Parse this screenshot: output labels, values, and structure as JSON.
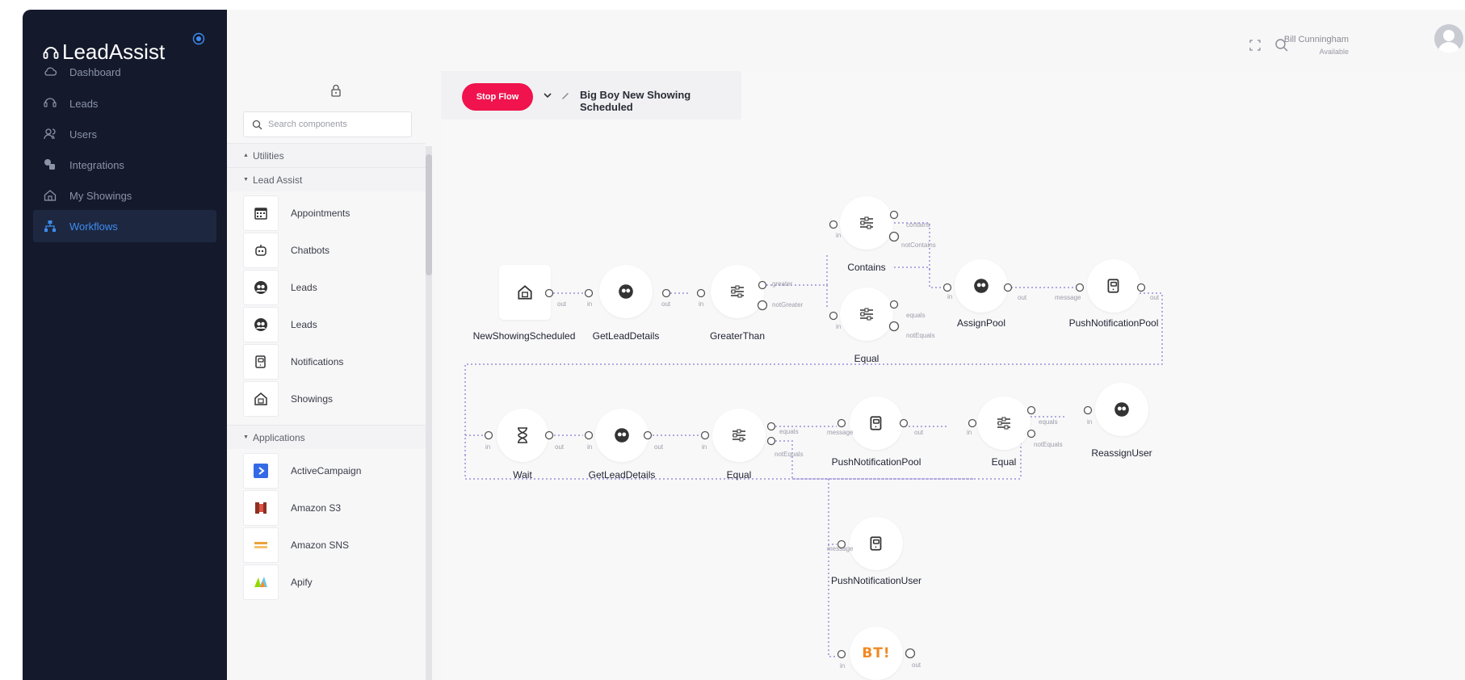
{
  "app": {
    "brand": "LeadAssist",
    "accent_color": "#3d8cf0",
    "sidebar_bg": "#141a2c"
  },
  "nav": {
    "items": [
      {
        "label": "Dashboard",
        "icon": "cloud-icon"
      },
      {
        "label": "Leads",
        "icon": "lead-icon"
      },
      {
        "label": "Users",
        "icon": "users-icon"
      },
      {
        "label": "Integrations",
        "icon": "puzzle-icon"
      },
      {
        "label": "My Showings",
        "icon": "home-icon"
      },
      {
        "label": "Workflows",
        "icon": "workflow-icon",
        "active": true
      }
    ]
  },
  "header": {
    "user_name": "Bill Cunningham",
    "user_status": "Available",
    "icons": [
      "expand-icon",
      "search-icon"
    ]
  },
  "panel": {
    "search_placeholder": "Search components",
    "groups": {
      "utilities": "Utilities",
      "lead_assist": "Lead Assist",
      "applications": "Applications"
    },
    "lead_assist_items": [
      "Appointments",
      "Chatbots",
      "Leads",
      "Leads",
      "Notifications",
      "Showings"
    ],
    "application_items": [
      "ActiveCampaign",
      "Amazon S3",
      "Amazon SNS",
      "Apify"
    ]
  },
  "toolbar": {
    "stop_label": "Stop Flow",
    "flow_name": "Big Boy New Showing Scheduled",
    "stop_color": "#f0134d"
  },
  "flow": {
    "nodes": {
      "n1": "NewShowingScheduled",
      "n2": "GetLeadDetails",
      "n3": "GreaterThan",
      "n4": "Contains",
      "n5": "Equal",
      "n6": "AssignPool",
      "n7": "PushNotificationPool",
      "n8": "Wait",
      "n9": "GetLeadDetails",
      "n10": "Equal",
      "n11": "PushNotificationPool",
      "n12": "Equal",
      "n13": "ReassignUser",
      "n14": "PushNotificationUser",
      "n15_icon_text": "BT!"
    },
    "ports": {
      "in": "in",
      "out": "out",
      "greater": "greater",
      "notGreater": "notGreater",
      "contains": "contains",
      "notContains": "notContains",
      "equals": "equals",
      "notEquals": "notEquals",
      "message": "message"
    }
  }
}
